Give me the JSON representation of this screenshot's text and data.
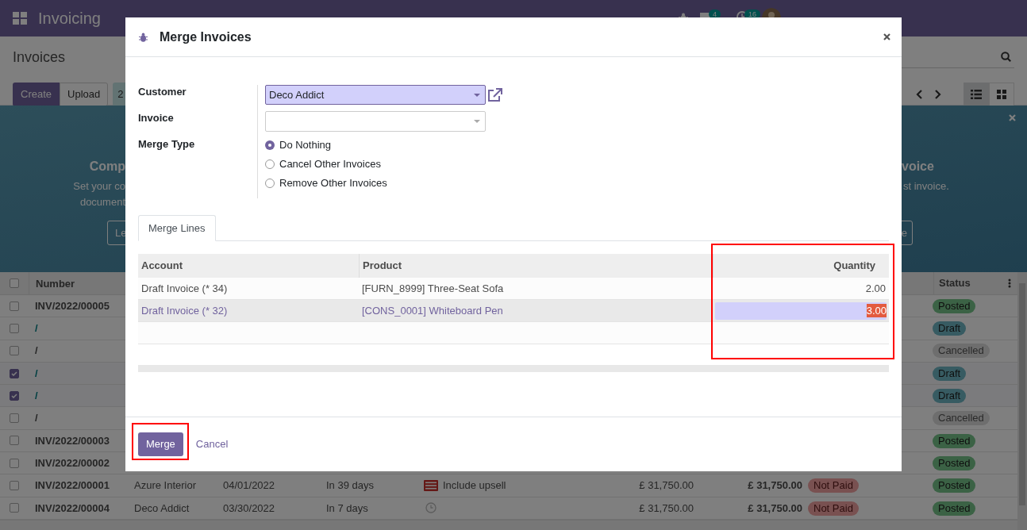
{
  "navbar": {
    "app_name": "Invoicing",
    "messages_count": "4",
    "activities_count": "16"
  },
  "control_panel": {
    "title": "Invoices",
    "buttons": [
      "Create",
      "Upload"
    ],
    "selected_count": "2"
  },
  "banner": {
    "left_title": "Comp",
    "left_lines": [
      "Set your co",
      "document"
    ],
    "left_button": "Le",
    "right_title": "voice",
    "right_line": "st invoice.",
    "right_button": "e"
  },
  "list": {
    "columns": {
      "number": "Number",
      "status": "Status"
    },
    "all_selected": false,
    "rows": [
      {
        "number": "INV/2022/00005",
        "kind": "posted",
        "selected": false,
        "status": "Posted"
      },
      {
        "number": "/",
        "kind": "draft",
        "selected": false,
        "status": "Draft"
      },
      {
        "number": "/",
        "kind": "cancelled",
        "selected": false,
        "status": "Cancelled"
      },
      {
        "number": "/",
        "kind": "draft",
        "selected": true,
        "status": "Draft"
      },
      {
        "number": "/",
        "kind": "draft",
        "selected": true,
        "status": "Draft"
      },
      {
        "number": "/",
        "kind": "cancelled",
        "selected": false,
        "status": "Cancelled"
      },
      {
        "number": "INV/2022/00003",
        "kind": "posted",
        "selected": false,
        "status": "Posted"
      },
      {
        "number": "INV/2022/00002",
        "kind": "posted",
        "selected": false,
        "status": "Posted"
      },
      {
        "number": "INV/2022/00001",
        "kind": "posted",
        "selected": false,
        "status": "Posted",
        "customer": "Azure Interior",
        "invoice_date": "04/01/2022",
        "due": "In 39 days",
        "activity": {
          "kind": "list",
          "label": "Include upsell"
        },
        "untaxed": "£ 31,750.00",
        "total": "£ 31,750.00",
        "payment_status": "Not Paid"
      },
      {
        "number": "INV/2022/00004",
        "kind": "posted",
        "selected": false,
        "status": "Posted",
        "customer": "Deco Addict",
        "invoice_date": "03/30/2022",
        "due": "In 7 days",
        "activity": {
          "kind": "clock"
        },
        "untaxed": "£ 31,750.00",
        "total": "£ 31,750.00",
        "payment_status": "Not Paid"
      }
    ]
  },
  "dialog": {
    "title": "Merge Invoices",
    "fields": {
      "customer": {
        "label": "Customer",
        "value": "Deco Addict"
      },
      "invoice": {
        "label": "Invoice"
      },
      "merge_type": {
        "label": "Merge Type",
        "options": [
          {
            "label": "Do Nothing",
            "selected": true
          },
          {
            "label": "Cancel Other Invoices",
            "selected": false
          },
          {
            "label": "Remove Other Invoices",
            "selected": false
          }
        ]
      }
    },
    "tabs": [
      {
        "label": "Merge Lines",
        "selected": true
      }
    ],
    "table": {
      "columns": [
        "Account",
        "Product",
        "Quantity"
      ],
      "rows": [
        {
          "account": "Draft Invoice (* 34)",
          "product": "[FURN_8999] Three-Seat Sofa",
          "quantity": "2.00",
          "selected": false
        },
        {
          "account": "Draft Invoice (* 32)",
          "product": "[CONS_0001] Whiteboard Pen",
          "quantity": "3.00",
          "selected": true
        }
      ]
    },
    "buttons": {
      "primary": "Merge",
      "secondary": "Cancel"
    }
  }
}
